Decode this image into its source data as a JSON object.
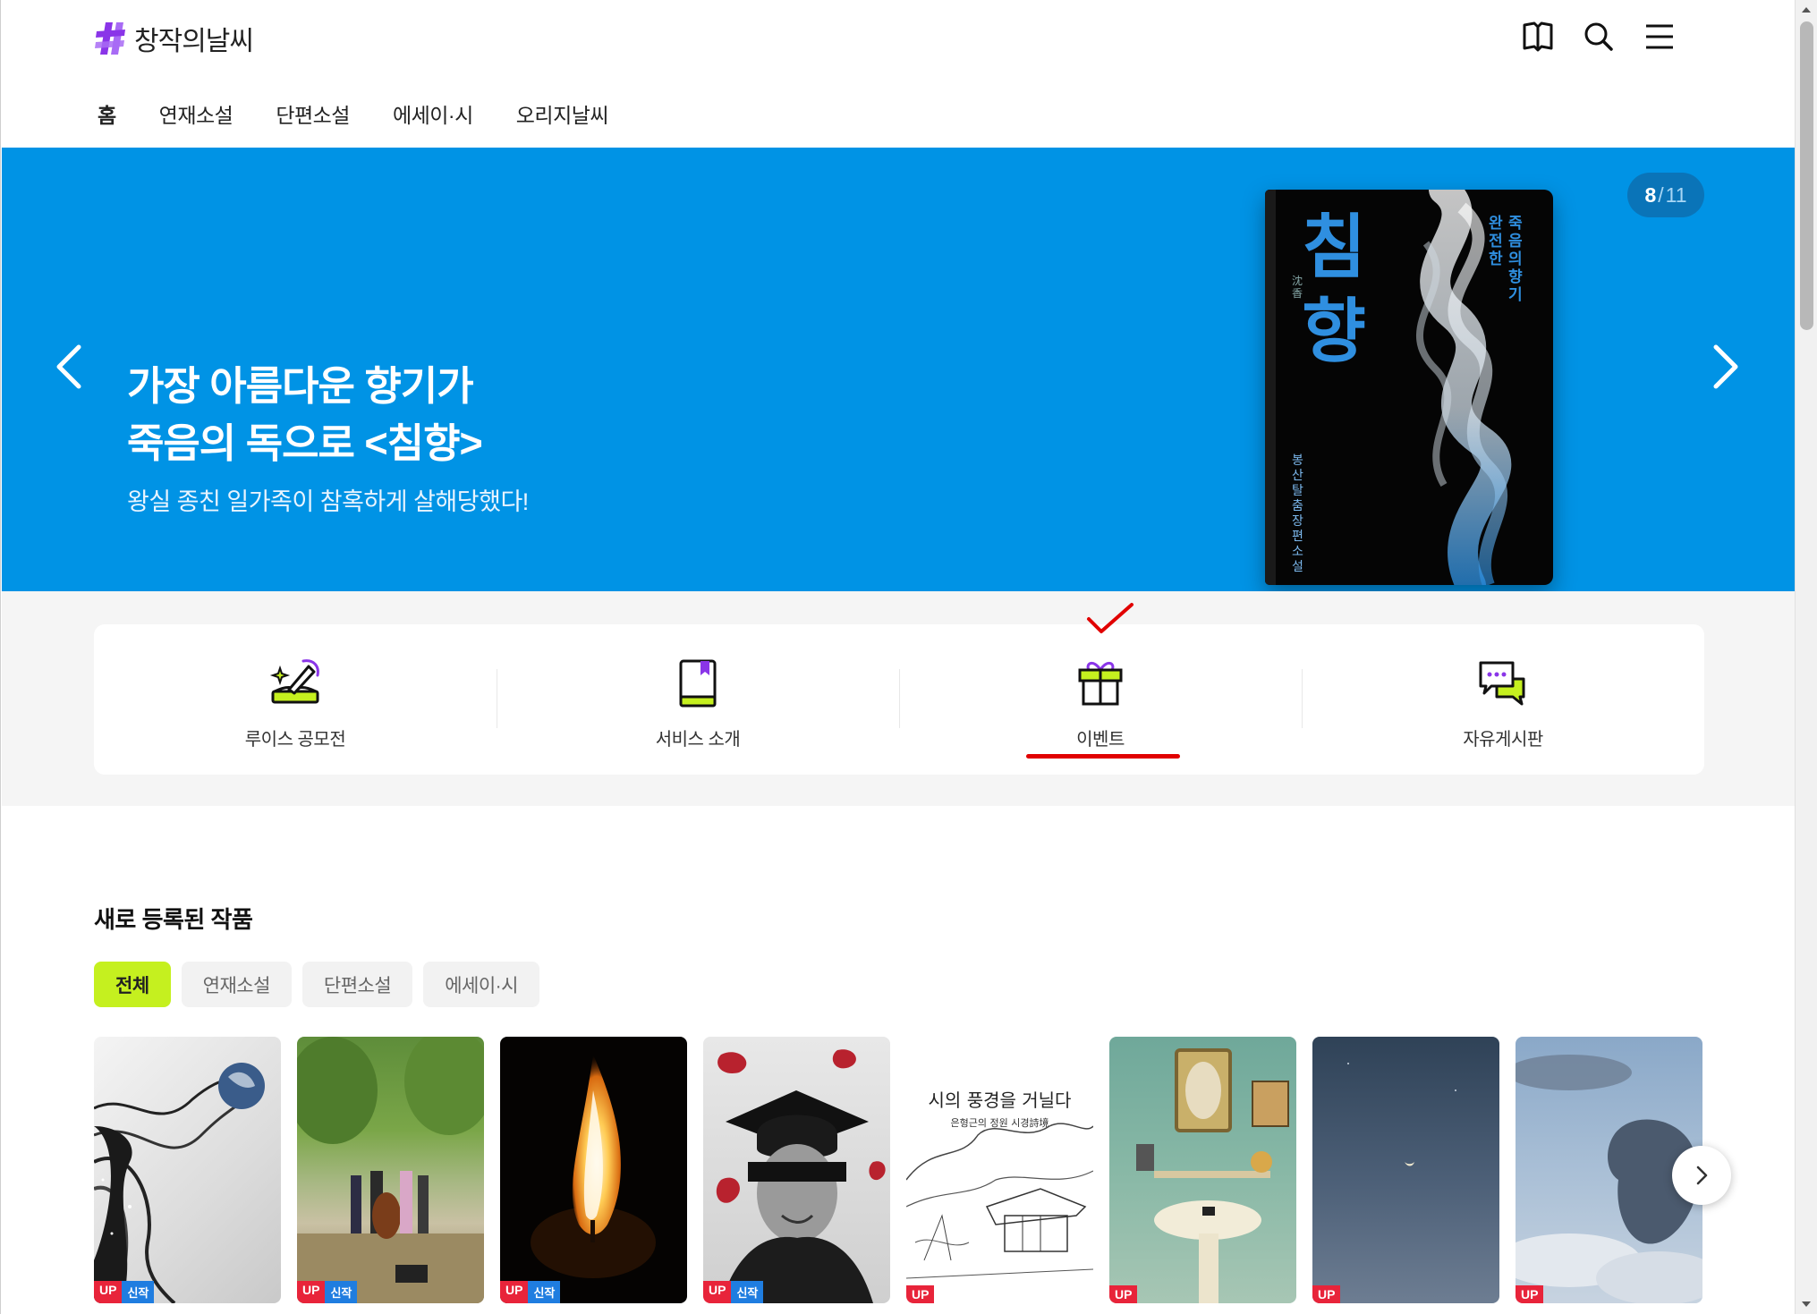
{
  "header": {
    "logo_text": "창작의날씨",
    "icons": [
      "book-icon",
      "search-icon",
      "menu-icon"
    ]
  },
  "gnb": [
    {
      "label": "홈",
      "active": true
    },
    {
      "label": "연재소설",
      "active": false
    },
    {
      "label": "단편소설",
      "active": false
    },
    {
      "label": "에세이·시",
      "active": false
    },
    {
      "label": "오리지날씨",
      "active": false
    }
  ],
  "banner": {
    "title_line1": "가장 아름다운 향기가",
    "title_line2": "죽음의 독으로 <침향>",
    "subtitle": "왕실 종친 일가족이 참혹하게 살해당했다!",
    "counter_current": "8",
    "counter_sep": "/",
    "counter_total": "11",
    "background": "#0093e5",
    "book": {
      "title": "침향",
      "hanja": "沈香",
      "tagline_col1": "완전한",
      "tagline_col2": "죽음의 향기",
      "author": "봉산탈춤 장편소설"
    }
  },
  "quick_menu": [
    {
      "label": "루이스 공모전",
      "icon": "writing-contest-icon"
    },
    {
      "label": "서비스 소개",
      "icon": "book-bookmark-icon"
    },
    {
      "label": "이벤트",
      "icon": "gift-icon"
    },
    {
      "label": "자유게시판",
      "icon": "chat-bubbles-icon"
    }
  ],
  "new_works": {
    "title": "새로 등록된 작품",
    "chips": [
      {
        "label": "전체",
        "active": true
      },
      {
        "label": "연재소설",
        "active": false
      },
      {
        "label": "단편소설",
        "active": false
      },
      {
        "label": "에세이·시",
        "active": false
      }
    ],
    "badge_up": "UP",
    "badge_new": "신작",
    "cards": [
      {
        "cover": "earth-waves",
        "new": true
      },
      {
        "cover": "street-musicians",
        "new": true
      },
      {
        "cover": "candle-flame",
        "new": true
      },
      {
        "cover": "graduate-portrait",
        "new": true
      },
      {
        "cover": "poetry-sketch",
        "new": false,
        "title": "시의 풍경을 거닐다",
        "subtitle": "은형근의 정원 시경詩境"
      },
      {
        "cover": "vintage-bathroom",
        "new": false
      },
      {
        "cover": "night-moon",
        "new": false
      },
      {
        "cover": "cloud-sky",
        "new": false
      }
    ]
  },
  "colors": {
    "accent_lime": "#c5f01f",
    "badge_red": "#e8243a",
    "badge_blue": "#1f7de0",
    "logo_purple": "#8a35e8"
  }
}
